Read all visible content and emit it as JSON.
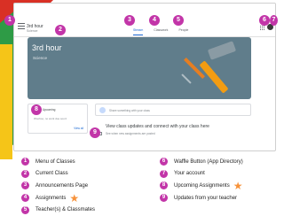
{
  "app": {
    "class_name": "3rd hour",
    "class_subtitle": "Science"
  },
  "tabs": [
    {
      "label": "Stream",
      "active": true
    },
    {
      "label": "Classwork",
      "active": false
    },
    {
      "label": "People",
      "active": false
    }
  ],
  "banner": {
    "title": "3rd hour",
    "subtitle": "Science"
  },
  "upcoming": {
    "title": "Upcoming",
    "text": "Woohoo, no work due soon!",
    "link": "View all"
  },
  "announce": {
    "placeholder": "Share something with your class"
  },
  "stream_hint": {
    "main": "View class updates and connect with your class here",
    "sub": "See when new assignments are posted"
  },
  "badges": [
    "1",
    "2",
    "3",
    "4",
    "5",
    "6",
    "7",
    "8",
    "9"
  ],
  "legend": {
    "left": [
      {
        "num": "1",
        "label": "Menu of Classes",
        "star": false
      },
      {
        "num": "2",
        "label": "Current Class",
        "star": false
      },
      {
        "num": "3",
        "label": "Announcements Page",
        "star": false
      },
      {
        "num": "4",
        "label": "Assignments",
        "star": true
      },
      {
        "num": "5",
        "label": "Teacher(s) & Classmates",
        "star": false
      }
    ],
    "right": [
      {
        "num": "6",
        "label": "Waffle Button (App Directory)",
        "star": false
      },
      {
        "num": "7",
        "label": "Your account",
        "star": false
      },
      {
        "num": "8",
        "label": "Upcoming Assignments",
        "star": true
      },
      {
        "num": "9",
        "label": "Updates from your teacher",
        "star": false
      }
    ]
  },
  "colors": {
    "badge": "#c235a8",
    "accent": "#1967d2",
    "banner": "#607d8b",
    "star": "#f7923a"
  },
  "icons": [
    "menu-icon",
    "apps-grid-icon",
    "account-avatar",
    "star-icon",
    "hammer-icon",
    "screwdriver-icon"
  ]
}
